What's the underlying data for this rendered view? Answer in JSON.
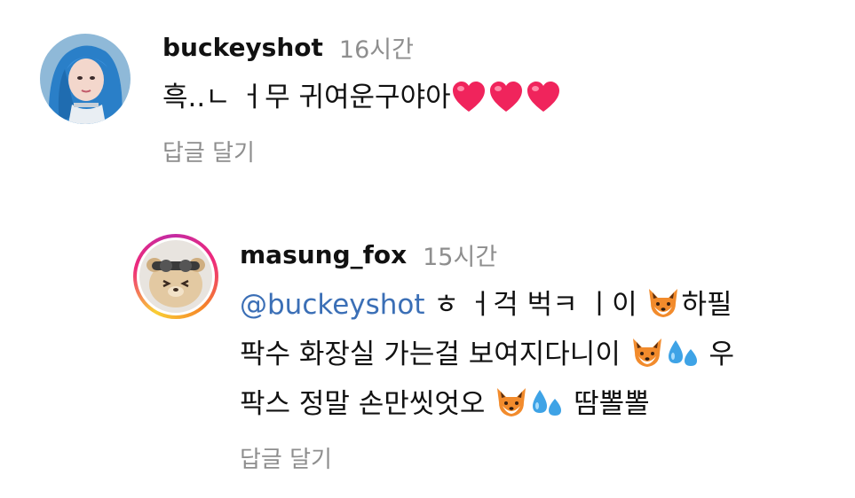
{
  "comments": [
    {
      "username": "buckeyshot",
      "time": "16시간",
      "text": "흑..ㄴ ㅓ무 귀여운구야아",
      "reply_label": "답글 달기"
    },
    {
      "username": "masung_fox",
      "time": "15시간",
      "mention": "@buckeyshot",
      "text_line1_a": " ㅎ ㅓ걱 벅ㅋ ㅣ이 ",
      "text_line1_b": "하필",
      "text_line2": "팍수 화장실 가는걸 보여지다니이 ",
      "text_line2_b": " 우",
      "text_line3": "팍스 정말 손만씻엇오 ",
      "text_line3_b": " 땀뽈뽈",
      "reply_label": "답글 달기"
    }
  ],
  "colors": {
    "username": "#111111",
    "meta": "#8e8e8e",
    "mention": "#3b6fb6",
    "heart": "#f0245c",
    "story_ring": [
      "#f9ce34",
      "#ee2a7b",
      "#c32aa3"
    ]
  },
  "icons": [
    "heart-emoji",
    "fox-emoji",
    "sweat-droplets-emoji"
  ]
}
